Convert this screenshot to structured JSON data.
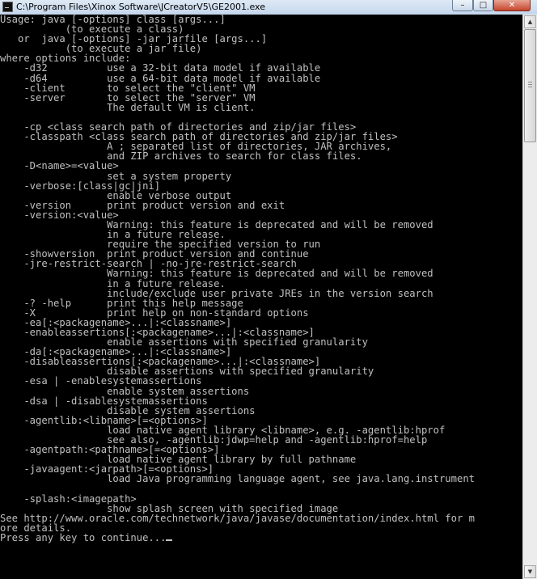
{
  "window": {
    "title": "C:\\Program Files\\Xinox Software\\JCreatorV5\\GE2001.exe",
    "minimize_glyph": "–",
    "maximize_glyph": "□",
    "close_glyph": "✕"
  },
  "console": {
    "lines": [
      "Usage: java [-options] class [args...]",
      "           (to execute a class)",
      "   or  java [-options] -jar jarfile [args...]",
      "           (to execute a jar file)",
      "where options include:",
      "    -d32          use a 32-bit data model if available",
      "    -d64          use a 64-bit data model if available",
      "    -client       to select the \"client\" VM",
      "    -server       to select the \"server\" VM",
      "                  The default VM is client.",
      "",
      "    -cp <class search path of directories and zip/jar files>",
      "    -classpath <class search path of directories and zip/jar files>",
      "                  A ; separated list of directories, JAR archives,",
      "                  and ZIP archives to search for class files.",
      "    -D<name>=<value>",
      "                  set a system property",
      "    -verbose:[class|gc|jni]",
      "                  enable verbose output",
      "    -version      print product version and exit",
      "    -version:<value>",
      "                  Warning: this feature is deprecated and will be removed",
      "                  in a future release.",
      "                  require the specified version to run",
      "    -showversion  print product version and continue",
      "    -jre-restrict-search | -no-jre-restrict-search",
      "                  Warning: this feature is deprecated and will be removed",
      "                  in a future release.",
      "                  include/exclude user private JREs in the version search",
      "    -? -help      print this help message",
      "    -X            print help on non-standard options",
      "    -ea[:<packagename>...|:<classname>]",
      "    -enableassertions[:<packagename>...|:<classname>]",
      "                  enable assertions with specified granularity",
      "    -da[:<packagename>...|:<classname>]",
      "    -disableassertions[:<packagename>...|:<classname>]",
      "                  disable assertions with specified granularity",
      "    -esa | -enablesystemassertions",
      "                  enable system assertions",
      "    -dsa | -disablesystemassertions",
      "                  disable system assertions",
      "    -agentlib:<libname>[=<options>]",
      "                  load native agent library <libname>, e.g. -agentlib:hprof",
      "                  see also, -agentlib:jdwp=help and -agentlib:hprof=help",
      "    -agentpath:<pathname>[=<options>]",
      "                  load native agent library by full pathname",
      "    -javaagent:<jarpath>[=<options>]",
      "                  load Java programming language agent, see java.lang.instrument",
      "",
      "    -splash:<imagepath>",
      "                  show splash screen with specified image",
      "See http://www.oracle.com/technetwork/java/javase/documentation/index.html for m",
      "ore details.",
      "Press any key to continue..."
    ]
  },
  "scrollbar": {
    "up_glyph": "▲",
    "down_glyph": "▼"
  }
}
